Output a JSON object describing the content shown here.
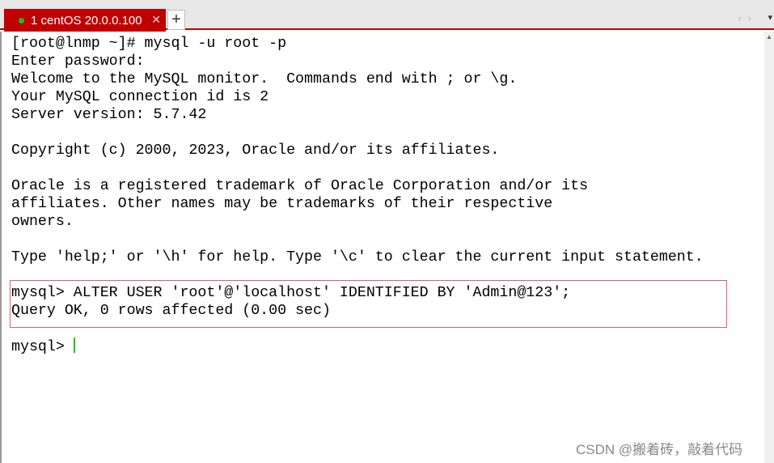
{
  "tabs": [
    {
      "label": "1 centOS 20.0.0.100",
      "status_color": "#19c219"
    }
  ],
  "terminal": {
    "lines": [
      "[root@lnmp ~]# mysql -u root -p",
      "Enter password:",
      "Welcome to the MySQL monitor.  Commands end with ; or \\g.",
      "Your MySQL connection id is 2",
      "Server version: 5.7.42",
      "",
      "Copyright (c) 2000, 2023, Oracle and/or its affiliates.",
      "",
      "Oracle is a registered trademark of Oracle Corporation and/or its",
      "affiliates. Other names may be trademarks of their respective",
      "owners.",
      "",
      "Type 'help;' or '\\h' for help. Type '\\c' to clear the current input statement.",
      "",
      "mysql> ALTER USER 'root'@'localhost' IDENTIFIED BY 'Admin@123';",
      "Query OK, 0 rows affected (0.00 sec)",
      "",
      "mysql> "
    ]
  },
  "watermark": "CSDN @搬着砖，敲着代码",
  "colors": {
    "accent": "#c00000",
    "cursor": "#19c219",
    "highlight_box": "#e06060"
  }
}
